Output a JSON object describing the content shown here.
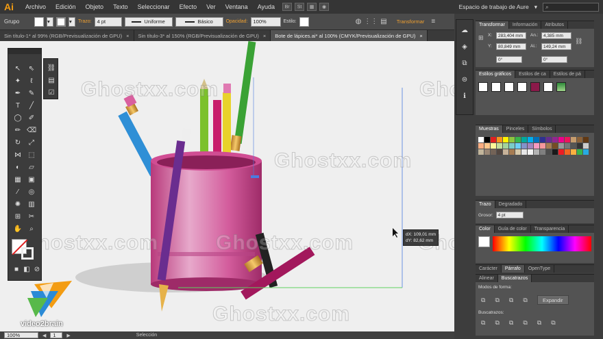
{
  "app": {
    "logo": "Ai"
  },
  "menu": {
    "items": [
      "Archivo",
      "Edición",
      "Objeto",
      "Texto",
      "Seleccionar",
      "Efecto",
      "Ver",
      "Ventana",
      "Ayuda"
    ],
    "btn1": "Br",
    "btn2": "St",
    "workspace": "Espacio de trabajo de Aure",
    "search_placeholder": ""
  },
  "control": {
    "selection": "Grupo",
    "stroke_label": "Trazo:",
    "stroke_value": "4 pt",
    "profile": "Uniforme",
    "brush": "Básico",
    "opacity_label": "Opacidad:",
    "opacity_value": "100%",
    "style_label": "Estilo:",
    "transform_link": "Transformar"
  },
  "tabs": [
    {
      "label": "Sin título-1* al 99% (RGB/Previsualización de GPU)"
    },
    {
      "label": "Sin título-3* al 150% (RGB/Previsualización de GPU)"
    },
    {
      "label": "Bote de lápices.ai* al 100% (CMYK/Previsualización de GPU)"
    }
  ],
  "canvas": {
    "measure_dx": "dX: 109,01 mm",
    "measure_dy": "dY: 82,62 mm",
    "watermark": "Ghostxx.com",
    "brand": "video2brain"
  },
  "status": {
    "zoom": "100%",
    "page": "1",
    "tool": "Selección"
  },
  "transform": {
    "tabs": [
      "Transformar",
      "Información",
      "Atributos"
    ],
    "x_label": "X:",
    "x": "283,404 mm",
    "w_label": "An.:",
    "w": "4,385 mm",
    "y_label": "Y:",
    "y": "80,849 mm",
    "h_label": "Al.:",
    "h": "149,24 mm",
    "rot": "0°",
    "shear": "0°"
  },
  "graphic_styles": {
    "tabs": [
      "Estilos gráficos",
      "Estilos de ca",
      "Estilos de pá"
    ]
  },
  "swatches": {
    "tabs": [
      "Muestras",
      "Pinceles",
      "Símbolos"
    ]
  },
  "stroke": {
    "tabs": [
      "Trazo",
      "Degradado"
    ],
    "weight_label": "Grosor:",
    "weight": "4 pt"
  },
  "color": {
    "tabs": [
      "Color",
      "Guía de color",
      "Transparencia"
    ]
  },
  "character": {
    "tabs": [
      "Carácter",
      "Párrafo",
      "OpenType"
    ]
  },
  "pathfinder": {
    "tabs": [
      "Alinear",
      "Buscatrazos"
    ],
    "modes_label": "Modos de forma:",
    "expand": "Expandir",
    "finders_label": "Buscatrazos:"
  },
  "colors": {
    "pink": "#d94f9a",
    "app_bg": "#535353",
    "accent": "#f39c12"
  }
}
